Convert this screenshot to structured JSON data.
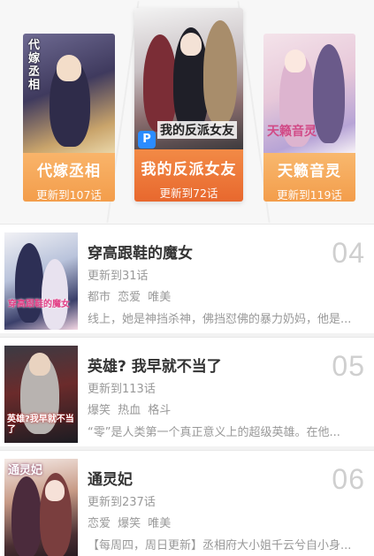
{
  "featured": [
    {
      "title": "代嫁丞相",
      "update": "更新到107话",
      "cover_text": "代嫁丞相"
    },
    {
      "title": "我的反派女友",
      "update": "更新到72话",
      "cover_text": "我的反派女友",
      "badge": "P"
    },
    {
      "title": "天籁音灵",
      "update": "更新到119话",
      "cover_text": "天籁音灵"
    }
  ],
  "ranking": [
    {
      "rank": "04",
      "title": "穿高跟鞋的魔女",
      "update": "更新到31话",
      "tags": "都市 恋爱 唯美",
      "desc": "线上，她是神挡杀神，佛挡怼佛的暴力奶妈，他是...",
      "cover_text": "穿高跟鞋的魔女"
    },
    {
      "rank": "05",
      "title": "英雄? 我早就不当了",
      "update": "更新到113话",
      "tags": "爆笑 热血 格斗",
      "desc": "“零”是人类第一个真正意义上的超级英雄。在他...",
      "cover_text": "英雄?我早就不当了"
    },
    {
      "rank": "06",
      "title": "通灵妃",
      "update": "更新到237话",
      "tags": "恋爱 爆笑 唯美",
      "desc": "【每周四，周日更新】丞相府大小姐千云兮自小身...",
      "cover_text": "通灵妃"
    }
  ]
}
